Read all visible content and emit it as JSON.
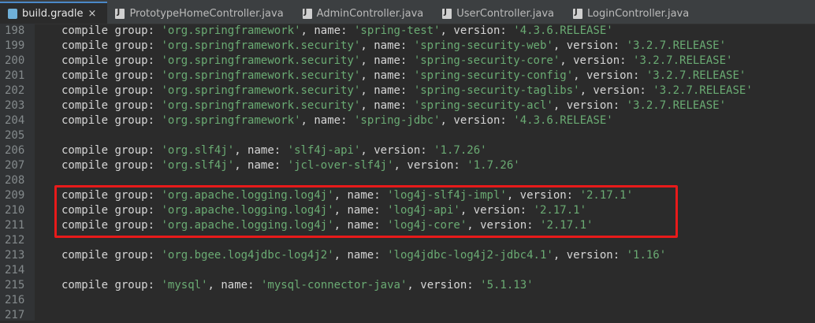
{
  "tabs": [
    {
      "label": "build.gradle",
      "icon": "gradle-icon",
      "active": true,
      "close": "×"
    },
    {
      "label": "PrototypeHomeController.java",
      "icon": "java-file-icon"
    },
    {
      "label": "AdminController.java",
      "icon": "java-file-icon"
    },
    {
      "label": "UserController.java",
      "icon": "java-file-icon"
    },
    {
      "label": "LoginController.java",
      "icon": "java-file-icon"
    }
  ],
  "lines": [
    {
      "n": "198",
      "g": "org.springframework",
      "a": "spring-test",
      "v": "4.3.6.RELEASE"
    },
    {
      "n": "199",
      "g": "org.springframework.security",
      "a": "spring-security-web",
      "v": "3.2.7.RELEASE"
    },
    {
      "n": "200",
      "g": "org.springframework.security",
      "a": "spring-security-core",
      "v": "3.2.7.RELEASE"
    },
    {
      "n": "201",
      "g": "org.springframework.security",
      "a": "spring-security-config",
      "v": "3.2.7.RELEASE"
    },
    {
      "n": "202",
      "g": "org.springframework.security",
      "a": "spring-security-taglibs",
      "v": "3.2.7.RELEASE"
    },
    {
      "n": "203",
      "g": "org.springframework.security",
      "a": "spring-security-acl",
      "v": "3.2.7.RELEASE"
    },
    {
      "n": "204",
      "g": "org.springframework",
      "a": "spring-jdbc",
      "v": "4.3.6.RELEASE"
    },
    {
      "n": "205"
    },
    {
      "n": "206",
      "g": "org.slf4j",
      "a": "slf4j-api",
      "v": "1.7.26"
    },
    {
      "n": "207",
      "g": "org.slf4j",
      "a": "jcl-over-slf4j",
      "v": "1.7.26"
    },
    {
      "n": "208"
    },
    {
      "n": "209",
      "g": "org.apache.logging.log4j",
      "a": "log4j-slf4j-impl",
      "v": "2.17.1"
    },
    {
      "n": "210",
      "g": "org.apache.logging.log4j",
      "a": "log4j-api",
      "v": "2.17.1"
    },
    {
      "n": "211",
      "g": "org.apache.logging.log4j",
      "a": "log4j-core",
      "v": "2.17.1"
    },
    {
      "n": "212"
    },
    {
      "n": "213",
      "g": "org.bgee.log4jdbc-log4j2",
      "a": "log4jdbc-log4j2-jdbc4.1",
      "v": "1.16"
    },
    {
      "n": "214"
    },
    {
      "n": "215",
      "g": "mysql",
      "a": "mysql-connector-java",
      "v": "5.1.13"
    },
    {
      "n": "216"
    },
    {
      "n": "217"
    }
  ],
  "tokens": {
    "kw": "compile",
    "group": "group:",
    "name": ", name:",
    "version": ", version:"
  },
  "highlight": {
    "lines": [
      "209",
      "210",
      "211"
    ],
    "color": "#e81a1a"
  },
  "colors": {
    "background": "#2b2b2b",
    "string": "#6aab73",
    "text": "#d6d6d6",
    "line_number": "#848a8c",
    "tab_accent": "#4a88c7"
  }
}
